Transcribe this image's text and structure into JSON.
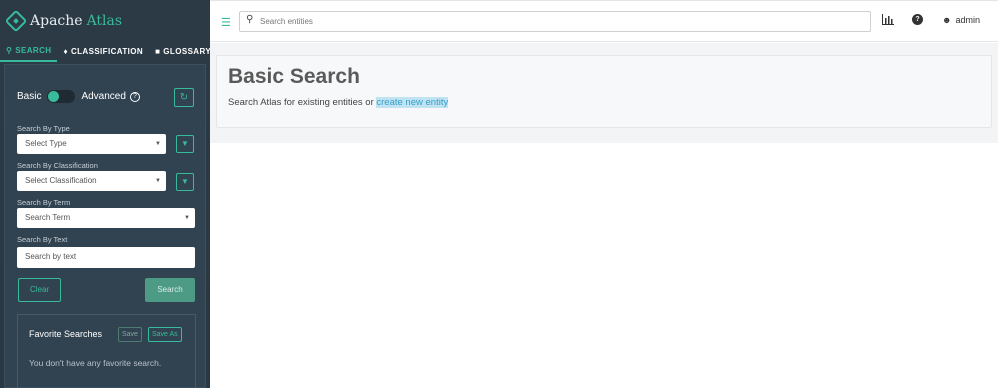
{
  "brand": {
    "name_part1": "Apache",
    "name_part2": "Atlas"
  },
  "tabs": [
    {
      "icon": "search-icon",
      "label": "SEARCH",
      "active": true
    },
    {
      "icon": "tag-icon",
      "label": "CLASSIFICATION",
      "active": false
    },
    {
      "icon": "folder-icon",
      "label": "GLOSSARY",
      "active": false
    }
  ],
  "mode_toggle": {
    "left_label": "Basic",
    "right_label": "Advanced",
    "help_glyph": "?"
  },
  "filters": {
    "type": {
      "label": "Search By Type",
      "placeholder": "Select Type"
    },
    "classification": {
      "label": "Search By Classification",
      "placeholder": "Select Classification"
    },
    "term": {
      "label": "Search By Term",
      "placeholder": "Search Term"
    },
    "text": {
      "label": "Search By Text",
      "placeholder": "Search by text"
    }
  },
  "actions": {
    "clear": "Clear",
    "search": "Search"
  },
  "favorites": {
    "title": "Favorite Searches",
    "save": "Save",
    "save_as": "Save As",
    "empty_message": "You don't have any favorite search."
  },
  "header": {
    "search_placeholder": "Search entities",
    "user": "admin"
  },
  "main": {
    "title": "Basic Search",
    "subtitle_prefix": "Search Atlas for existing entities or ",
    "create_link": "create new entity"
  },
  "colors": {
    "accent": "#37bb9b",
    "sidebar": "#2c3a46",
    "link": "#37a0c8"
  }
}
